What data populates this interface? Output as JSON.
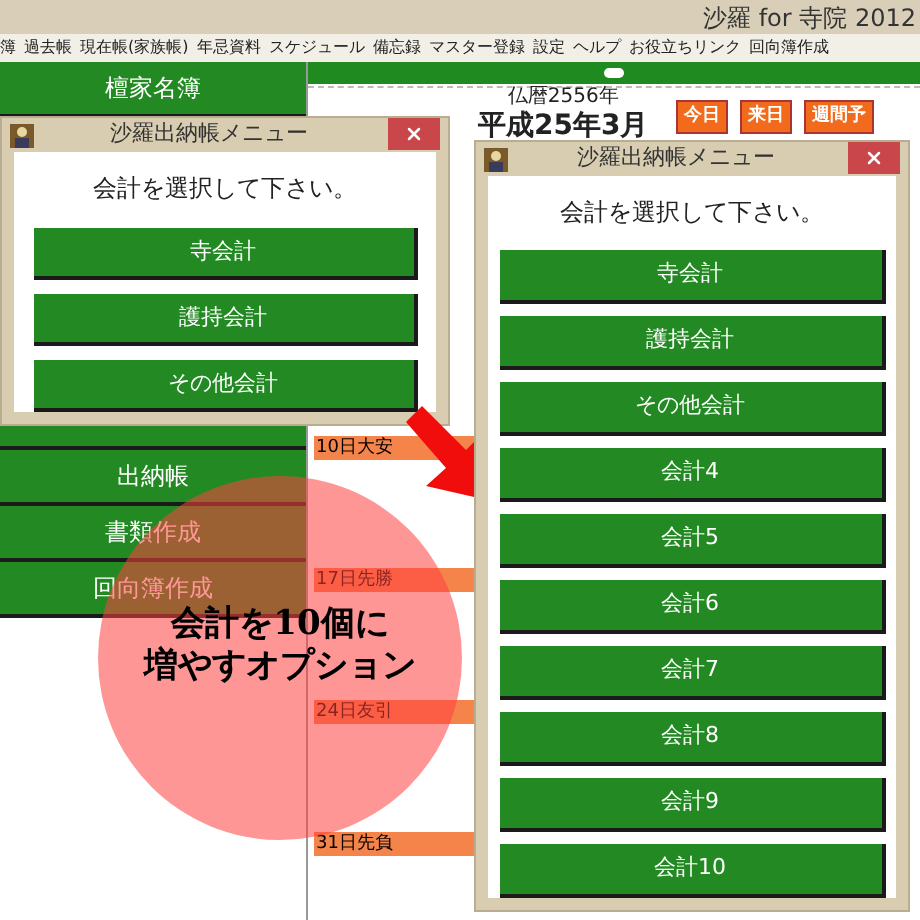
{
  "app": {
    "title": "沙羅 for 寺院 2012"
  },
  "menu": [
    "簿",
    "過去帳",
    "現在帳(家族帳)",
    "年忌資料",
    "スケジュール",
    "備忘録",
    "マスター登録",
    "設定",
    "ヘルプ",
    "お役立ちリンク",
    "回向簿作成"
  ],
  "sidebar": {
    "top": [
      "檀家名簿"
    ],
    "bottom": [
      "出納帳",
      "書類作成",
      "回向簿作成"
    ]
  },
  "calendar": {
    "era_year": "仏暦2556年",
    "month": "平成25年3月",
    "buttons": [
      "今日",
      "来日",
      "週間予"
    ],
    "days": [
      "10日大安",
      "17日先勝",
      "24日友引",
      "31日先負"
    ]
  },
  "dialogs": [
    {
      "title": "沙羅出納帳メニュー",
      "prompt": "会計を選択して下さい。",
      "buttons": [
        "寺会計",
        "護持会計",
        "その他会計"
      ]
    },
    {
      "title": "沙羅出納帳メニュー",
      "prompt": "会計を選択して下さい。",
      "buttons": [
        "寺会計",
        "護持会計",
        "その他会計",
        "会計4",
        "会計5",
        "会計6",
        "会計7",
        "会計8",
        "会計9",
        "会計10"
      ]
    }
  ],
  "callout": {
    "lines": [
      "会計を10個に",
      "増やすオプション"
    ]
  }
}
